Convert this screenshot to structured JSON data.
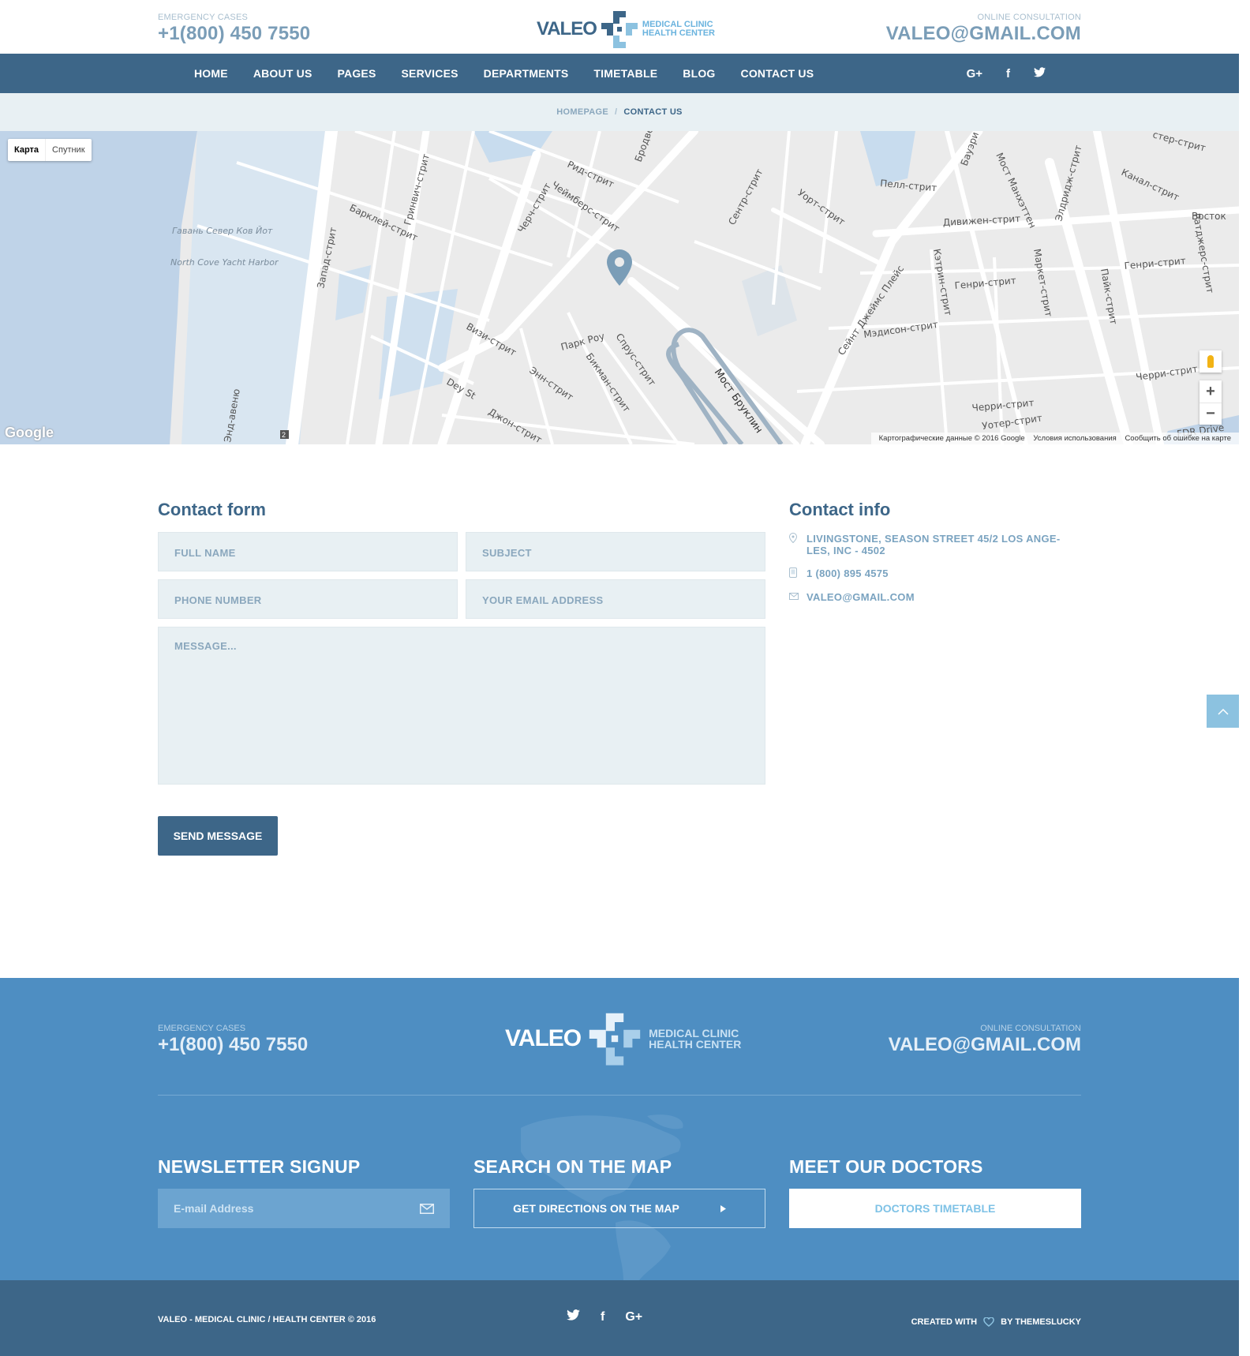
{
  "header": {
    "emergency_label": "EMERGENCY CASES",
    "emergency_phone": "+1(800) 450 7550",
    "logo_word": "VALEO",
    "logo_line1": "MEDICAL CLINIC",
    "logo_line2": "HEALTH CENTER",
    "consult_label": "ONLINE CONSULTATION",
    "consult_email": "VALEO@GMAIL.COM"
  },
  "nav": {
    "items": [
      "HOME",
      "ABOUT US",
      "PAGES",
      "SERVICES",
      "DEPARTMENTS",
      "TIMETABLE",
      "BLOG",
      "CONTACT US"
    ],
    "social": [
      "G+",
      "f",
      "t"
    ]
  },
  "breadcrumb": {
    "home": "HOMEPAGE",
    "sep": "/",
    "current": "CONTACT US"
  },
  "map": {
    "type_map": "Карта",
    "type_sat": "Спутник",
    "google": "Google",
    "attribution": "Картографические данные © 2016 Google",
    "terms": "Условия использования",
    "report": "Сообщить об ошибке на карте",
    "labels": {
      "harbor": "Гавань Север Ков Йот",
      "harbor_en": "North Cove Yacht Harbor",
      "west_st": "Запад-стрит",
      "barclay": "Барклей-стрит",
      "greenwich": "Гринвич-стрит",
      "church": "Черч-стрит",
      "chambers": "Чеймберс-стрит",
      "reed": "Рид-стрит",
      "broadway": "Бродве",
      "center": "Сентр-стрит",
      "worth": "Уорт-стрит",
      "pell": "Пелл-стрит",
      "division": "Дивижен-стрит",
      "henry": "Генри-стрит",
      "henry2": "Генри-стрит",
      "madison": "Мэдисон-стрит",
      "catherine": "Кэтрин-стрит",
      "jamesplace": "Сейнт Джеймс Плейс",
      "market": "Маркет-стрит",
      "manhattan_bridge": "Мост Манхэттен",
      "pike": "Пайк-стрит",
      "rutgers": "Ратджерс-стрит",
      "canal": "Канал-стрит",
      "cherry": "Черри-стрит",
      "cherry2": "Черри-стрит",
      "water": "Уотер-стрит",
      "fdr": "FDR Drive",
      "vesey": "Визи-стрит",
      "park_row": "Парк Роу",
      "spruce": "Спрус-стрит",
      "beekman": "Бикман-стрит",
      "ann": "Энн-стрит",
      "dey": "Dey St",
      "john": "Джон-стрит",
      "brooklyn_bridge": "Мост Бруклин",
      "end_ave": "Энд-авеню",
      "bowery": "Бауэри",
      "east": "Восток",
      "eldridge": "Элдридж-стрит",
      "chester": "стер-стрит",
      "route_2": "2"
    }
  },
  "contact_form": {
    "title": "Contact form",
    "full_name": "FULL NAME",
    "subject": "SUBJECT",
    "phone": "PHONE NUMBER",
    "email": "YOUR EMAIL ADDRESS",
    "message": "MESSAGE...",
    "send": "SEND MESSAGE"
  },
  "contact_info": {
    "title": "Contact info",
    "address_line1": "LIVINGSTONE, SEASON STREET 45/2 LOS ANGE-",
    "address_line2": "LES, INC - 4502",
    "phone": "1 (800) 895 4575",
    "email": "VALEO@GMAIL.COM"
  },
  "footer": {
    "emergency_label": "EMERGENCY CASES",
    "emergency_phone": "+1(800) 450 7550",
    "logo_word": "VALEO",
    "logo_line1": "MEDICAL CLINIC",
    "logo_line2": "HEALTH CENTER",
    "consult_label": "ONLINE CONSULTATION",
    "consult_email": "VALEO@GMAIL.COM",
    "newsletter_title": "NEWSLETTER SIGNUP",
    "newsletter_placeholder": "E-mail Address",
    "map_title": "SEARCH ON THE MAP",
    "directions": "GET DIRECTIONS ON THE MAP",
    "doctors_title": "MEET OUR DOCTORS",
    "timetable": "DOCTORS TIMETABLE"
  },
  "bottom": {
    "copyright": "VALEO - MEDICAL CLINIC / HEALTH CENTER © 2016",
    "created_with": "CREATED WITH",
    "by": "BY THEMESLUCKY"
  },
  "colors": {
    "nav": "#3d6688",
    "footer": "#4e8ec2",
    "field": "#e8f0f3",
    "accent": "#8cc2e0"
  }
}
